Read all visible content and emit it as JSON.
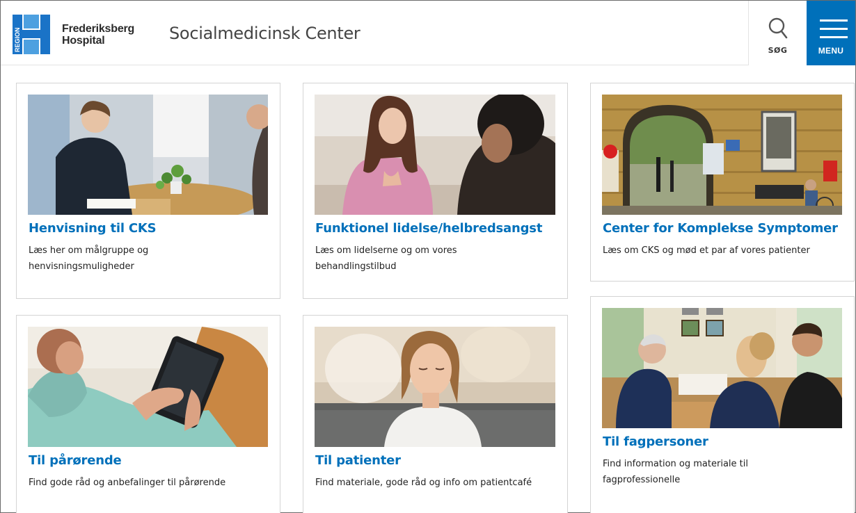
{
  "header": {
    "logo_region": "REGION",
    "logo_line1": "Frederiksberg",
    "logo_line2": "Hospital",
    "site_title": "Socialmedicinsk Center",
    "search_label": "SØG",
    "menu_label": "MENU"
  },
  "colors": {
    "brand_blue": "#0070ba",
    "logo_blue": "#1a73c7"
  },
  "cards": [
    {
      "title": "Henvisning til CKS",
      "desc_line1": "Læs her om målgruppe og",
      "desc_line2": "henvisningsmuligheder",
      "image": "consultation-photo"
    },
    {
      "title": "Funktionel lidelse/helbredsangst",
      "desc_line1": "Læs om lidelserne og om vores",
      "desc_line2": "behandlingstilbud",
      "image": "patient-talking-photo"
    },
    {
      "title": "Center for Komplekse Symptomer",
      "desc_line1": "Læs om CKS og mød et par af vores patienter",
      "desc_line2": "",
      "image": "hospital-gate-photo"
    },
    {
      "title": "Til pårørende",
      "desc_line1": "Find gode råd og anbefalinger til pårørende",
      "desc_line2": "",
      "image": "tablet-photo"
    },
    {
      "title": "Til patienter",
      "desc_line1": "Find materiale, gode råd og info om patientcafé",
      "desc_line2": "",
      "image": "relaxing-woman-photo"
    },
    {
      "title": "Til fagpersoner",
      "desc_line1": "Find information og materiale til",
      "desc_line2": "fagprofessionelle",
      "image": "meeting-photo"
    }
  ]
}
